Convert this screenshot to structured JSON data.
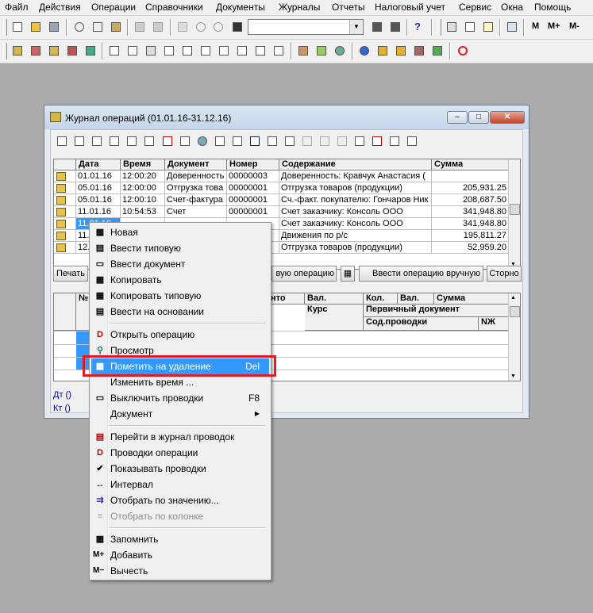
{
  "menubar": [
    "Файл",
    "Действия",
    "Операции",
    "Справочники",
    "Документы",
    "Журналы",
    "Отчеты",
    "Налоговый учет",
    "Сервис",
    "Окна",
    "Помощь"
  ],
  "toolbar": {
    "search_value": "",
    "m_label": "М",
    "mplus_label": "М+",
    "mminus_label": "М-"
  },
  "window": {
    "title": "Журнал операций  (01.01.16-31.12.16)",
    "columns": [
      "Дата",
      "Время",
      "Документ",
      "Номер",
      "Содержание",
      "Сумма"
    ],
    "rows": [
      {
        "date": "01.01.16",
        "time": "12:00:20",
        "doc": "Доверенность",
        "num": "00000003",
        "content": "Доверенность: Кравчук Анастасия (",
        "sum": ""
      },
      {
        "date": "05.01.16",
        "time": "12:00:00",
        "doc": "Отгрузка това",
        "num": "00000001",
        "content": "Отгрузка товаров (продукции)",
        "sum": "205,931.25"
      },
      {
        "date": "05.01.16",
        "time": "12:00:10",
        "doc": "Счет-фактура",
        "num": "00000001",
        "content": "Сч.-факт. покупателю: Гончаров Ник",
        "sum": "208,687.50"
      },
      {
        "date": "11.01.16",
        "time": "10:54:53",
        "doc": "Счет",
        "num": "00000001",
        "content": "Счет заказчику: Консоль ООО",
        "sum": "341,948.80"
      },
      {
        "date": "11.01.16",
        "time": "",
        "doc": "",
        "num": "",
        "content": "Счет заказчику: Консоль ООО",
        "sum": "341,948.80"
      },
      {
        "date": "11.",
        "time": "",
        "doc": "",
        "num": "",
        "content": "Движения по р/с",
        "sum": "195,811.27"
      },
      {
        "date": "12.",
        "time": "",
        "doc": "",
        "num": "",
        "content": "Отгрузка товаров (продукции)",
        "sum": "52,959.20"
      }
    ],
    "buttons": {
      "print": "Печать",
      "enter_op": "вую операцию",
      "enter_manual": "Ввести операцию вручную",
      "storno": "Сторно"
    },
    "lower_columns": {
      "no": "№",
      "cor": "нто",
      "val": "Вал.",
      "kurs": "Курс",
      "kol": "Кол.",
      "val2": "Вал.",
      "sum": "Сумма",
      "primary": "Первичный документ",
      "content_prov": "Сод.проводки",
      "nzh": "NЖ"
    },
    "dt_label": "Дт ()",
    "kt_label": "Кт ()"
  },
  "context_menu": [
    {
      "label": "Новая",
      "icon": "new-op-icon"
    },
    {
      "label": "Ввести типовую",
      "icon": "typical-icon"
    },
    {
      "label": "Ввести документ",
      "icon": "document-icon"
    },
    {
      "label": "Копировать",
      "icon": "copy-icon"
    },
    {
      "label": "Копировать типовую",
      "icon": "copy-typical-icon"
    },
    {
      "label": "Ввести на основании",
      "icon": "based-on-icon"
    },
    {
      "label": "Открыть операцию",
      "icon": "open-op-icon"
    },
    {
      "label": "Просмотр",
      "icon": "view-icon"
    },
    {
      "label": "Пометить на удаление",
      "shortcut": "Del",
      "icon": "delete-mark-icon",
      "highlighted": true
    },
    {
      "label": "Изменить время ...",
      "icon": ""
    },
    {
      "label": "Выключить проводки",
      "shortcut": "F8",
      "icon": "disable-postings-icon"
    },
    {
      "label": "Документ",
      "icon": "",
      "submenu": true
    },
    {
      "label": "Перейти в журнал проводок",
      "icon": "postings-journal-icon"
    },
    {
      "label": "Проводки операции",
      "icon": "op-postings-icon"
    },
    {
      "label": "Показывать проводки",
      "icon": "check-icon",
      "checked": true
    },
    {
      "label": "Интервал",
      "icon": "interval-icon"
    },
    {
      "label": "Отобрать по значению...",
      "icon": "filter-value-icon"
    },
    {
      "label": "Отобрать по колонке",
      "icon": "filter-column-icon",
      "disabled": true
    },
    {
      "label": "Запомнить",
      "icon": "remember-icon"
    },
    {
      "label": "Добавить",
      "icon": "add-icon",
      "glyph": "М+"
    },
    {
      "label": "Вычесть",
      "icon": "subtract-icon",
      "glyph": "М−"
    }
  ],
  "colors": {
    "highlight": "#3399ff",
    "annotation_box": "#e01b24",
    "row_select": "#3399ff"
  }
}
